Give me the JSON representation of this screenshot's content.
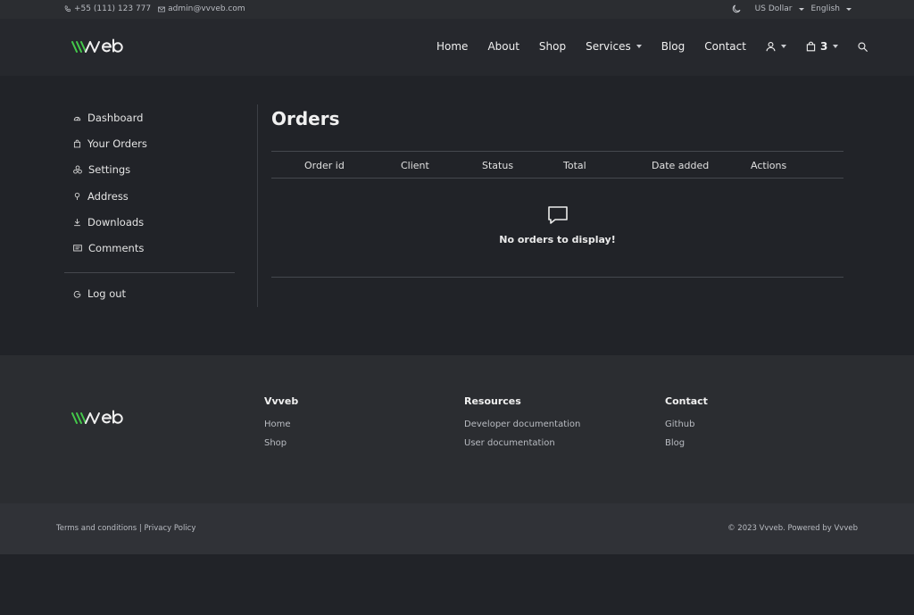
{
  "topbar": {
    "phone": "+55 (111) 123 777",
    "email": "admin@vvveb.com",
    "currency": "US Dollar",
    "language": "English"
  },
  "header": {
    "logo_text": "vvveb",
    "nav": [
      {
        "label": "Home"
      },
      {
        "label": "About"
      },
      {
        "label": "Shop"
      },
      {
        "label": "Services"
      },
      {
        "label": "Blog"
      },
      {
        "label": "Contact"
      }
    ],
    "cart_count": "3"
  },
  "sidebar": {
    "items": [
      {
        "label": "Dashboard",
        "icon": "dashboard-icon"
      },
      {
        "label": "Your Orders",
        "icon": "bag-icon"
      },
      {
        "label": "Settings",
        "icon": "settings-icon"
      },
      {
        "label": "Address",
        "icon": "map-pin-icon"
      },
      {
        "label": "Downloads",
        "icon": "download-icon"
      },
      {
        "label": "Comments",
        "icon": "comment-icon"
      }
    ],
    "logout": "Log out"
  },
  "orders": {
    "title": "Orders",
    "columns": [
      "Order id",
      "Client",
      "Status",
      "Total",
      "Date added",
      "Actions"
    ],
    "empty_message": "No orders to display!"
  },
  "footer": {
    "columns": [
      {
        "heading": "Vvveb",
        "links": [
          "Home",
          "Shop"
        ]
      },
      {
        "heading": "Resources",
        "links": [
          "Developer documentation",
          "User documentation"
        ]
      },
      {
        "heading": "Contact",
        "links": [
          "Github",
          "Blog"
        ]
      }
    ],
    "terms": "Terms and conditions",
    "separator": "|",
    "privacy": "Privacy Policy",
    "copyright": "© 2023 Vvveb. Powered by Vvveb"
  },
  "colors": {
    "brand_green": "#44c94a",
    "background": "#212328"
  }
}
